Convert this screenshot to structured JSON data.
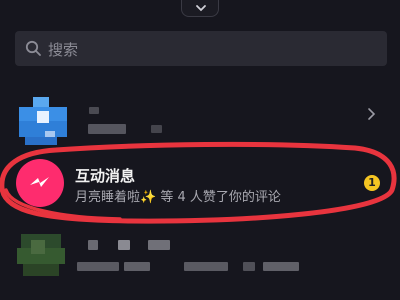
{
  "top_handle": {
    "icon": "chevron-down-icon"
  },
  "search": {
    "placeholder": "搜索",
    "icon": "search-icon"
  },
  "rows": [
    {
      "icon": "chevron-right-icon"
    },
    {
      "title": "互动消息",
      "subtitle": "月亮睡着啦✨ 等 4 人赞了你的评论",
      "badge": "1",
      "avatar_icon": "lightning-icon"
    }
  ],
  "colors": {
    "background": "#16161e",
    "search_bg": "#2a2a33",
    "interaction_avatar": "#fe2c6e",
    "badge": "#f5c522",
    "annotation_circle": "#e8343e"
  }
}
